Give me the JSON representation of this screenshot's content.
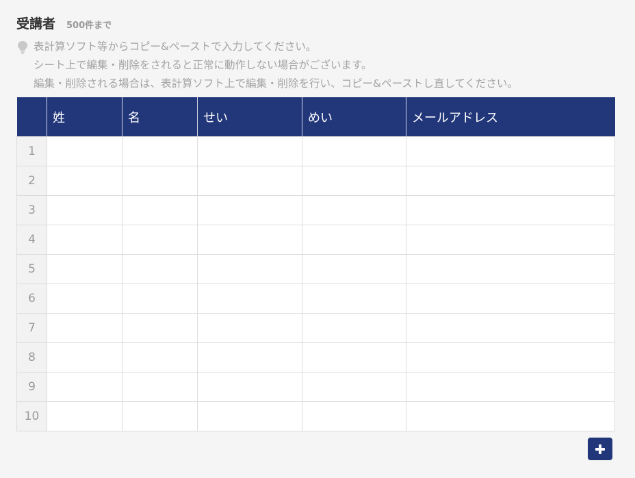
{
  "header": {
    "title": "受講者",
    "limit": "500件まで"
  },
  "note": {
    "icon": "lightbulb-icon",
    "lines": [
      "表計算ソフト等からコピー&ペーストで入力してください。",
      "シート上で編集・削除をされると正常に動作しない場合がございます。",
      "編集・削除される場合は、表計算ソフト上で編集・削除を行い、コピー&ペーストし直してください。"
    ]
  },
  "table": {
    "columns": [
      "",
      "姓",
      "名",
      "せい",
      "めい",
      "メールアドレス"
    ],
    "rows": [
      {
        "num": "1",
        "cells": [
          "",
          "",
          "",
          "",
          ""
        ]
      },
      {
        "num": "2",
        "cells": [
          "",
          "",
          "",
          "",
          ""
        ]
      },
      {
        "num": "3",
        "cells": [
          "",
          "",
          "",
          "",
          ""
        ]
      },
      {
        "num": "4",
        "cells": [
          "",
          "",
          "",
          "",
          ""
        ]
      },
      {
        "num": "5",
        "cells": [
          "",
          "",
          "",
          "",
          ""
        ]
      },
      {
        "num": "6",
        "cells": [
          "",
          "",
          "",
          "",
          ""
        ]
      },
      {
        "num": "7",
        "cells": [
          "",
          "",
          "",
          "",
          ""
        ]
      },
      {
        "num": "8",
        "cells": [
          "",
          "",
          "",
          "",
          ""
        ]
      },
      {
        "num": "9",
        "cells": [
          "",
          "",
          "",
          "",
          ""
        ]
      },
      {
        "num": "10",
        "cells": [
          "",
          "",
          "",
          "",
          ""
        ]
      }
    ]
  },
  "add_button": {
    "icon": "plus-icon"
  },
  "colors": {
    "header_bg": "#22367a",
    "page_bg": "#f5f5f5",
    "note_text": "#a3a3a3"
  }
}
